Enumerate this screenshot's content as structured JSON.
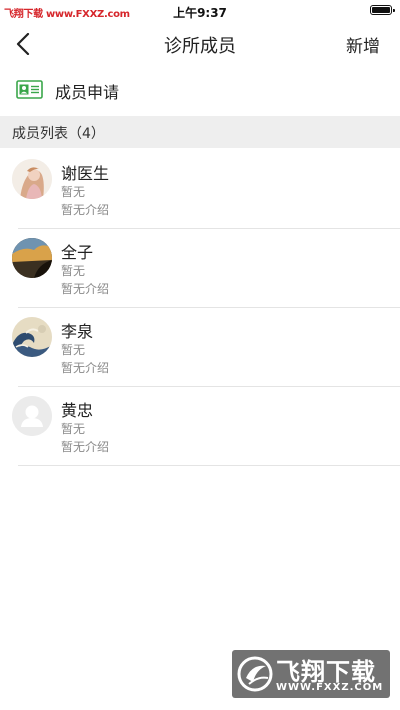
{
  "status_bar": {
    "watermark_text": "飞翔下载 www.FXXZ.com",
    "time": "上午9:37"
  },
  "nav": {
    "title": "诊所成员",
    "action": "新增"
  },
  "apply": {
    "label": "成员申请"
  },
  "section": {
    "title": "成员列表（4）"
  },
  "members": [
    {
      "name": "谢医生",
      "title": "暂无",
      "intro": "暂无介绍",
      "avatar": "photo-woman-avatar"
    },
    {
      "name": "全子",
      "title": "暂无",
      "intro": "暂无介绍",
      "avatar": "landscape-avatar"
    },
    {
      "name": "李泉",
      "title": "暂无",
      "intro": "暂无介绍",
      "avatar": "wave-painting-avatar"
    },
    {
      "name": "黄忠",
      "title": "暂无",
      "intro": "暂无介绍",
      "avatar": "default-person-avatar"
    }
  ],
  "watermark": {
    "main": "飞翔下载",
    "url": "WWW.FXXZ.COM"
  },
  "colors": {
    "accent_green": "#3aa64a",
    "watermark_red": "#d6262b",
    "section_bg": "#eeeeee",
    "secondary_text": "#8a8a8a"
  }
}
